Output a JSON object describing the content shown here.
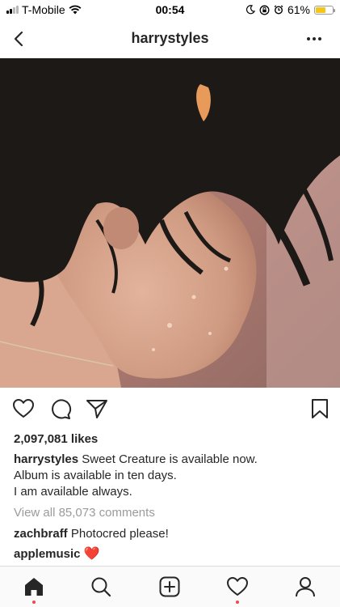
{
  "status_bar": {
    "carrier": "T-Mobile",
    "time": "00:54",
    "battery": "61%",
    "battery_level": 0.61
  },
  "header": {
    "title": "harrystyles"
  },
  "post": {
    "likes": "2,097,081 likes",
    "caption": {
      "user": "harrystyles",
      "text": "Sweet Creature is available now.",
      "lines": [
        "Album is available in ten days.",
        "I am available always."
      ]
    },
    "view_all": "View all 85,073 comments",
    "comments": [
      {
        "user": "zachbraff",
        "text": "Photocred please!"
      },
      {
        "user": "applemusic",
        "text": "❤️"
      }
    ]
  },
  "colors": {
    "accent": "#ed4956",
    "battery_fill": "#f5c518",
    "muted_text": "#9b9b9b"
  },
  "icons": {
    "back": "chevron-left-icon",
    "more": "more-dots-icon",
    "like": "heart-icon",
    "comment": "comment-bubble-icon",
    "share": "paper-plane-icon",
    "save": "bookmark-icon",
    "home": "home-icon",
    "search": "search-icon",
    "add": "add-post-icon",
    "activity": "activity-heart-icon",
    "profile": "profile-icon"
  }
}
